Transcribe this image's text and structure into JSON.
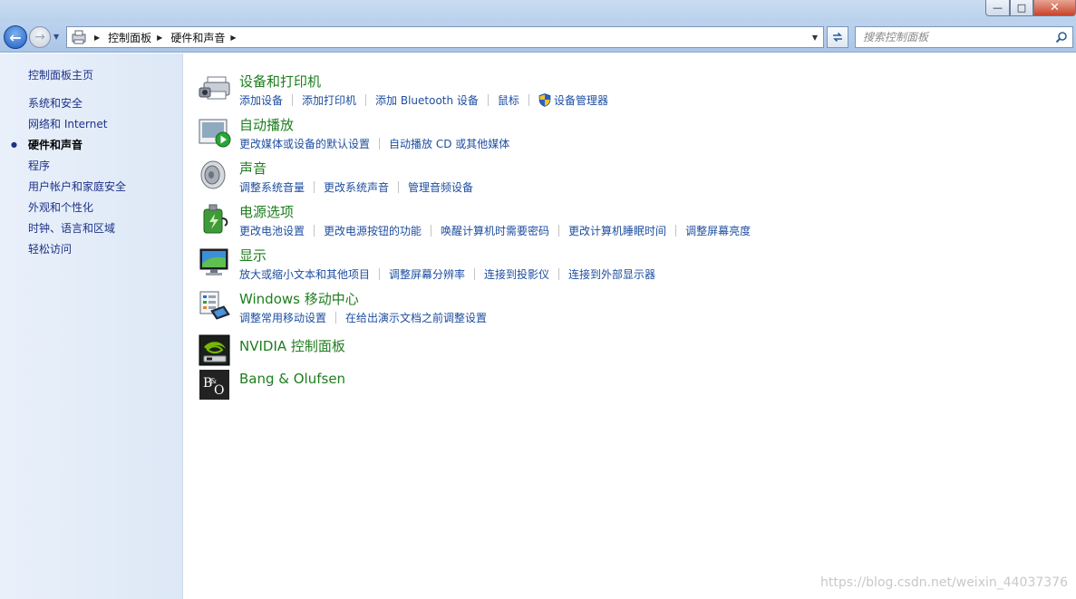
{
  "window": {
    "minimize_label": "—",
    "maximize_label": "□",
    "close_label": "✕"
  },
  "navigation": {
    "back_label": "←",
    "forward_label": "→",
    "breadcrumbs": [
      "控制面板",
      "硬件和声音"
    ],
    "search_placeholder": "搜索控制面板"
  },
  "sidebar": {
    "home": "控制面板主页",
    "items": [
      {
        "label": "系统和安全"
      },
      {
        "label": "网络和 Internet"
      },
      {
        "label": "硬件和声音",
        "active": true
      },
      {
        "label": "程序"
      },
      {
        "label": "用户帐户和家庭安全"
      },
      {
        "label": "外观和个性化"
      },
      {
        "label": "时钟、语言和区域"
      },
      {
        "label": "轻松访问"
      }
    ]
  },
  "categories": [
    {
      "icon": "printer-icon",
      "title": "设备和打印机",
      "links": [
        "添加设备",
        "添加打印机",
        "添加 Bluetooth 设备",
        "鼠标",
        "设备管理器"
      ]
    },
    {
      "icon": "autoplay-icon",
      "title": "自动播放",
      "links": [
        "更改媒体或设备的默认设置",
        "自动播放 CD 或其他媒体"
      ]
    },
    {
      "icon": "speaker-icon",
      "title": "声音",
      "links": [
        "调整系统音量",
        "更改系统声音",
        "管理音频设备"
      ]
    },
    {
      "icon": "power-icon",
      "title": "电源选项",
      "links": [
        "更改电池设置",
        "更改电源按钮的功能",
        "唤醒计算机时需要密码",
        "更改计算机睡眠时间",
        "调整屏幕亮度"
      ]
    },
    {
      "icon": "display-icon",
      "title": "显示",
      "links": [
        "放大或缩小文本和其他项目",
        "调整屏幕分辨率",
        "连接到投影仪",
        "连接到外部显示器"
      ]
    },
    {
      "icon": "mobility-center-icon",
      "title": "Windows 移动中心",
      "links": [
        "调整常用移动设置",
        "在给出演示文档之前调整设置"
      ]
    },
    {
      "icon": "nvidia-icon",
      "title": "NVIDIA 控制面板",
      "links": []
    },
    {
      "icon": "bang-olufsen-icon",
      "title": "Bang & Olufsen",
      "links": []
    }
  ],
  "watermark": "https://blog.csdn.net/weixin_44037376",
  "colors": {
    "link": "#1e4ea0",
    "category_title": "#1e7d1e",
    "sidebar_link": "#1e3287"
  }
}
